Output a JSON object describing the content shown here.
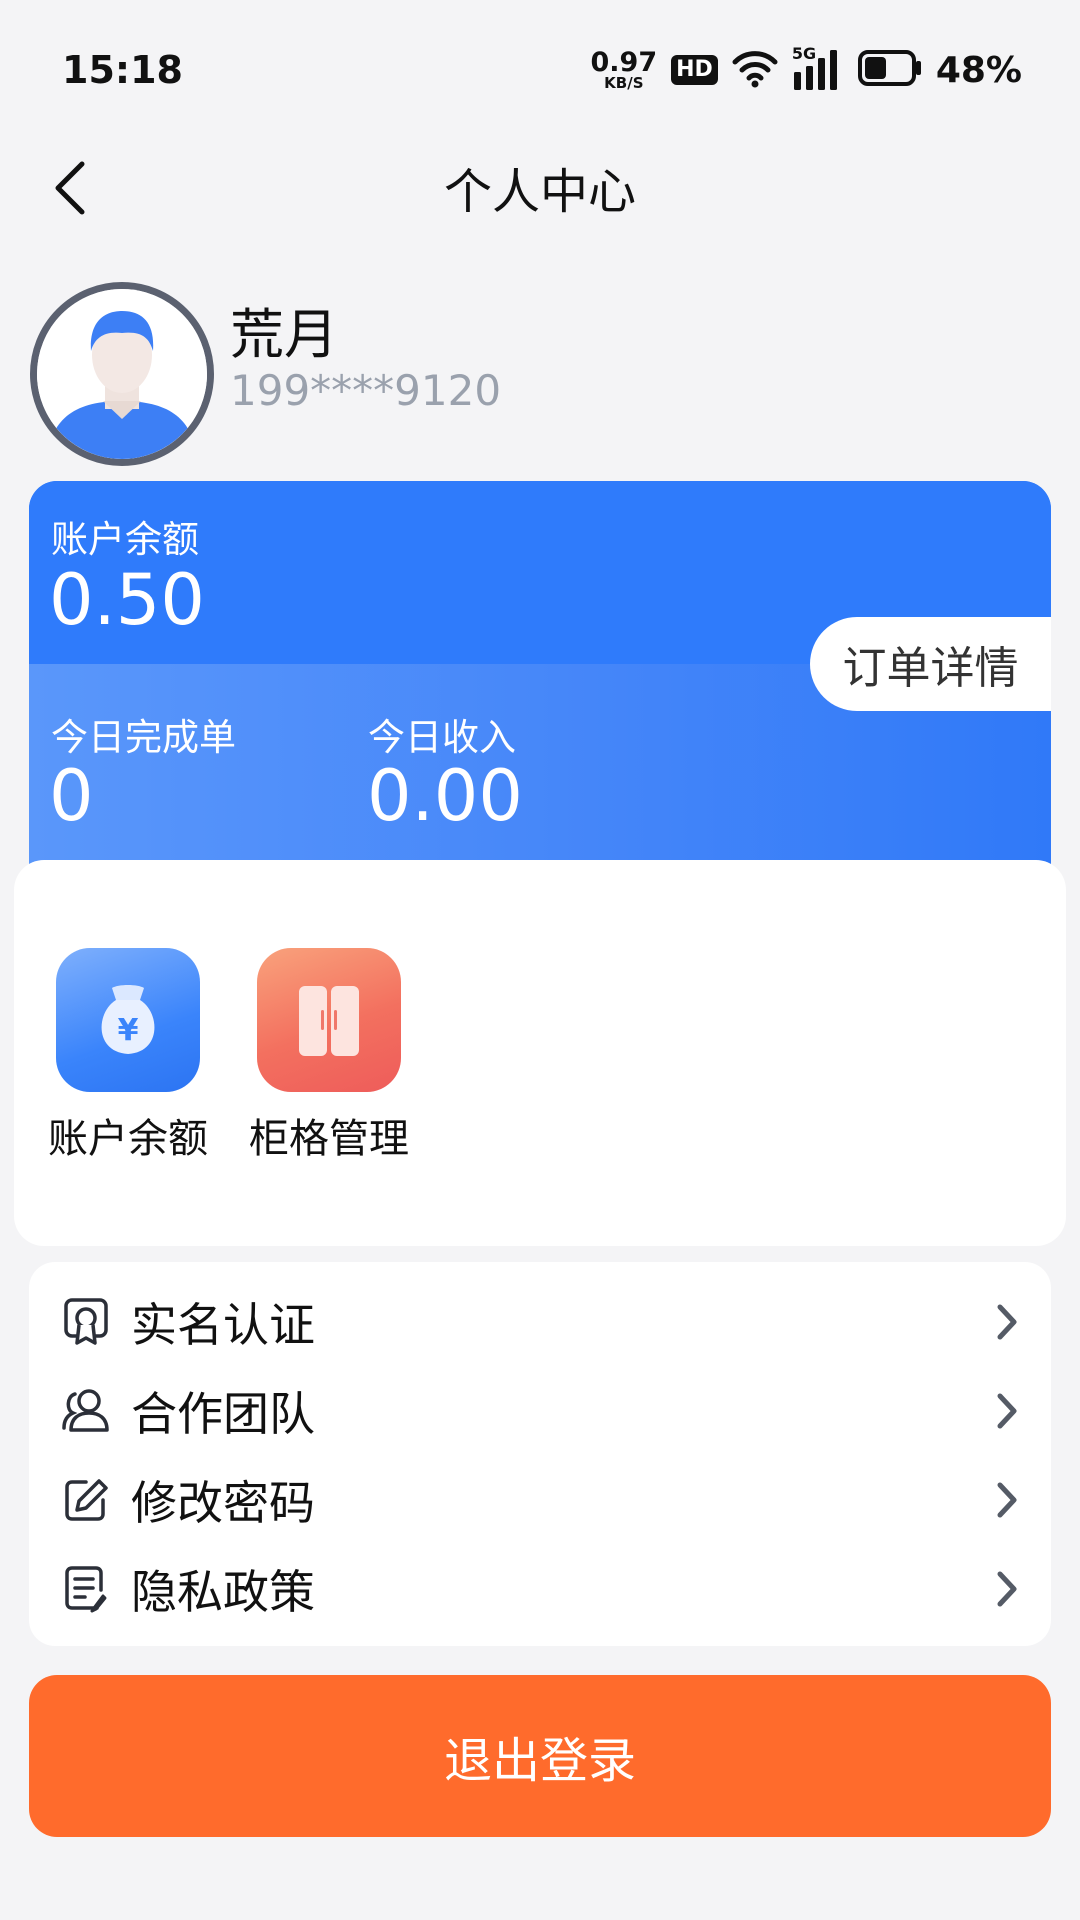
{
  "status_bar": {
    "time": "15:18",
    "net_speed_value": "0.97",
    "net_speed_unit": "KB/S",
    "hd_label": "HD",
    "network_label": "5G",
    "battery_percent": "48%",
    "battery_level": 0.48
  },
  "header": {
    "title": "个人中心",
    "back_icon": "back-arrow-icon"
  },
  "profile": {
    "name": "荒月",
    "phone": "199****9120",
    "avatar_icon": "user-avatar-icon"
  },
  "stats_card": {
    "balance_label": "账户余额",
    "balance_value": "0.50",
    "today_orders_label": "今日完成单",
    "today_orders_value": "0",
    "today_income_label": "今日收入",
    "today_income_value": "0.00",
    "order_detail_label": "订单详情",
    "colors": {
      "primary": "#2f7bfb"
    }
  },
  "shortcuts": [
    {
      "label": "账户余额",
      "icon": "money-bag-icon",
      "color": "#3a84fb"
    },
    {
      "label": "柜格管理",
      "icon": "cabinet-icon",
      "color": "#f36a5f"
    }
  ],
  "menu": [
    {
      "label": "实名认证",
      "icon": "certificate-icon"
    },
    {
      "label": "合作团队",
      "icon": "team-icon"
    },
    {
      "label": "修改密码",
      "icon": "edit-icon"
    },
    {
      "label": "隐私政策",
      "icon": "document-icon"
    }
  ],
  "logout": {
    "label": "退出登录",
    "color": "#ff6b2c"
  }
}
